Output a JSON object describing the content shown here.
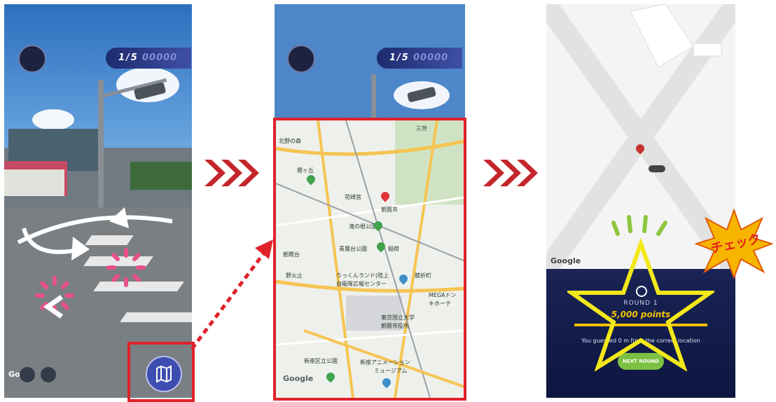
{
  "panel1": {
    "round_counter": "1/5",
    "score_placeholder": "00000",
    "google_label": "Go",
    "map_button_icon": "map-icon"
  },
  "panel2": {
    "round_counter": "1/5",
    "score_placeholder": "00000",
    "google_label": "Google",
    "map_labels": [
      {
        "text": "霞ヶ丘"
      },
      {
        "text": "花崎宮"
      },
      {
        "text": "朝霞市"
      },
      {
        "text": "滝の根公園"
      },
      {
        "text": "青葉台公園"
      },
      {
        "text": "稲荷"
      },
      {
        "text": "朝霞台"
      },
      {
        "text": "りっくんランド(陸上"
      },
      {
        "text": "自衛隊広報センター"
      },
      {
        "text": "MEGAドン"
      },
      {
        "text": "キホーテ"
      },
      {
        "text": "東京国立大学"
      },
      {
        "text": "朝霞市役所"
      },
      {
        "text": "新座アニメーション"
      },
      {
        "text": "ミュージアム"
      },
      {
        "text": "新座区立公園"
      },
      {
        "text": "北野の森"
      },
      {
        "text": "三芳"
      },
      {
        "text": "野火止"
      },
      {
        "text": "膝折町"
      }
    ]
  },
  "panel3": {
    "google_label": "Google",
    "round_label": "ROUND 1",
    "points_label": "5,000 points",
    "result_text": "You guessed 0 m from the correct location",
    "next_button": "NEXT ROUND",
    "check_badge": "チェック"
  },
  "colors": {
    "hud_blue": "#2a3a8c",
    "highlight_red": "#e0222a",
    "arrow_red": "#c4262c",
    "star_yellow": "#f3e81a",
    "points_gold": "#f2c200",
    "button_green": "#7cc142",
    "result_navy": "#0d1640"
  }
}
